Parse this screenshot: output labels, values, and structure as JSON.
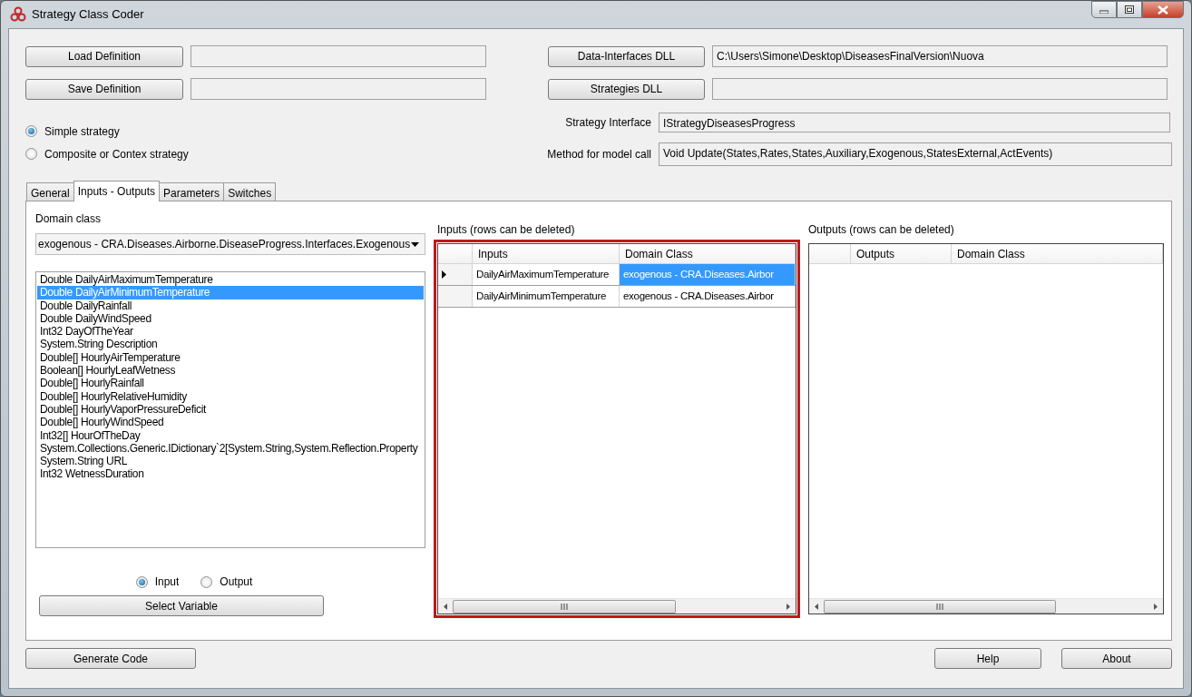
{
  "window": {
    "title": "Strategy Class Coder"
  },
  "file_rows_left": [
    {
      "button": "Load Definition"
    },
    {
      "button": "Save Definition"
    }
  ],
  "file_rows_right": [
    {
      "button": "Data-Interfaces DLL",
      "value": "C:\\Users\\Simone\\Desktop\\DiseasesFinalVersion\\Nuova"
    },
    {
      "button": "Strategies DLL"
    }
  ],
  "strategy_types": [
    {
      "label": "Simple strategy",
      "selected": true
    },
    {
      "label": "Composite or Contex strategy",
      "selected": false
    }
  ],
  "strategy_fields": [
    {
      "label": "Strategy Interface",
      "value": "IStrategyDiseasesProgress"
    },
    {
      "label": "Method for model call",
      "value": "Void Update(States,Rates,States,Auxiliary,Exogenous,StatesExternal,ActEvents)"
    }
  ],
  "tabs": [
    {
      "label": "General",
      "selected": false
    },
    {
      "label": "Inputs - Outputs",
      "selected": true
    },
    {
      "label": "Parameters",
      "selected": false
    },
    {
      "label": "Switches",
      "selected": false
    }
  ],
  "domain_class": {
    "label": "Domain class",
    "value": "exogenous - CRA.Diseases.Airborne.DiseaseProgress.Interfaces.Exogenous"
  },
  "variables": [
    {
      "label": "Double DailyAirMaximumTemperature",
      "selected": false
    },
    {
      "label": "Double DailyAirMinimumTemperature",
      "selected": true
    },
    {
      "label": "Double DailyRainfall",
      "selected": false
    },
    {
      "label": "Double DailyWindSpeed",
      "selected": false
    },
    {
      "label": "Int32 DayOfTheYear",
      "selected": false
    },
    {
      "label": "System.String Description",
      "selected": false
    },
    {
      "label": "Double[] HourlyAirTemperature",
      "selected": false
    },
    {
      "label": "Boolean[] HourlyLeafWetness",
      "selected": false
    },
    {
      "label": "Double[] HourlyRainfall",
      "selected": false
    },
    {
      "label": "Double[] HourlyRelativeHumidity",
      "selected": false
    },
    {
      "label": "Double[] HourlyVaporPressureDeficit",
      "selected": false
    },
    {
      "label": "Double[] HourlyWindSpeed",
      "selected": false
    },
    {
      "label": "Int32[] HourOfTheDay",
      "selected": false
    },
    {
      "label": "System.Collections.Generic.IDictionary`2[System.String,System.Reflection.Property",
      "selected": false
    },
    {
      "label": "System.String URL",
      "selected": false
    },
    {
      "label": "Int32 WetnessDuration",
      "selected": false
    }
  ],
  "direction": [
    {
      "label": "Input",
      "selected": true
    },
    {
      "label": "Output",
      "selected": false
    }
  ],
  "select_button": "Select Variable",
  "grids": [
    {
      "title": "Inputs (rows can be deleted)",
      "highlighted": true,
      "columns": [
        "Inputs",
        "Domain Class"
      ],
      "rows": [
        {
          "current": true,
          "cells": [
            {
              "text": "DailyAirMaximumTemperature",
              "selected": false
            },
            {
              "text": "exogenous - CRA.Diseases.Airbor",
              "selected": true
            }
          ]
        },
        {
          "current": false,
          "cells": [
            {
              "text": "DailyAirMinimumTemperature",
              "selected": false
            },
            {
              "text": "exogenous - CRA.Diseases.Airbor",
              "selected": false
            }
          ]
        }
      ]
    },
    {
      "title": "Outputs (rows can be deleted)",
      "highlighted": false,
      "columns": [
        "Outputs",
        "Domain Class"
      ]
    }
  ],
  "footer_left": [
    "Generate Code"
  ],
  "footer_right": [
    "Help",
    "About"
  ]
}
